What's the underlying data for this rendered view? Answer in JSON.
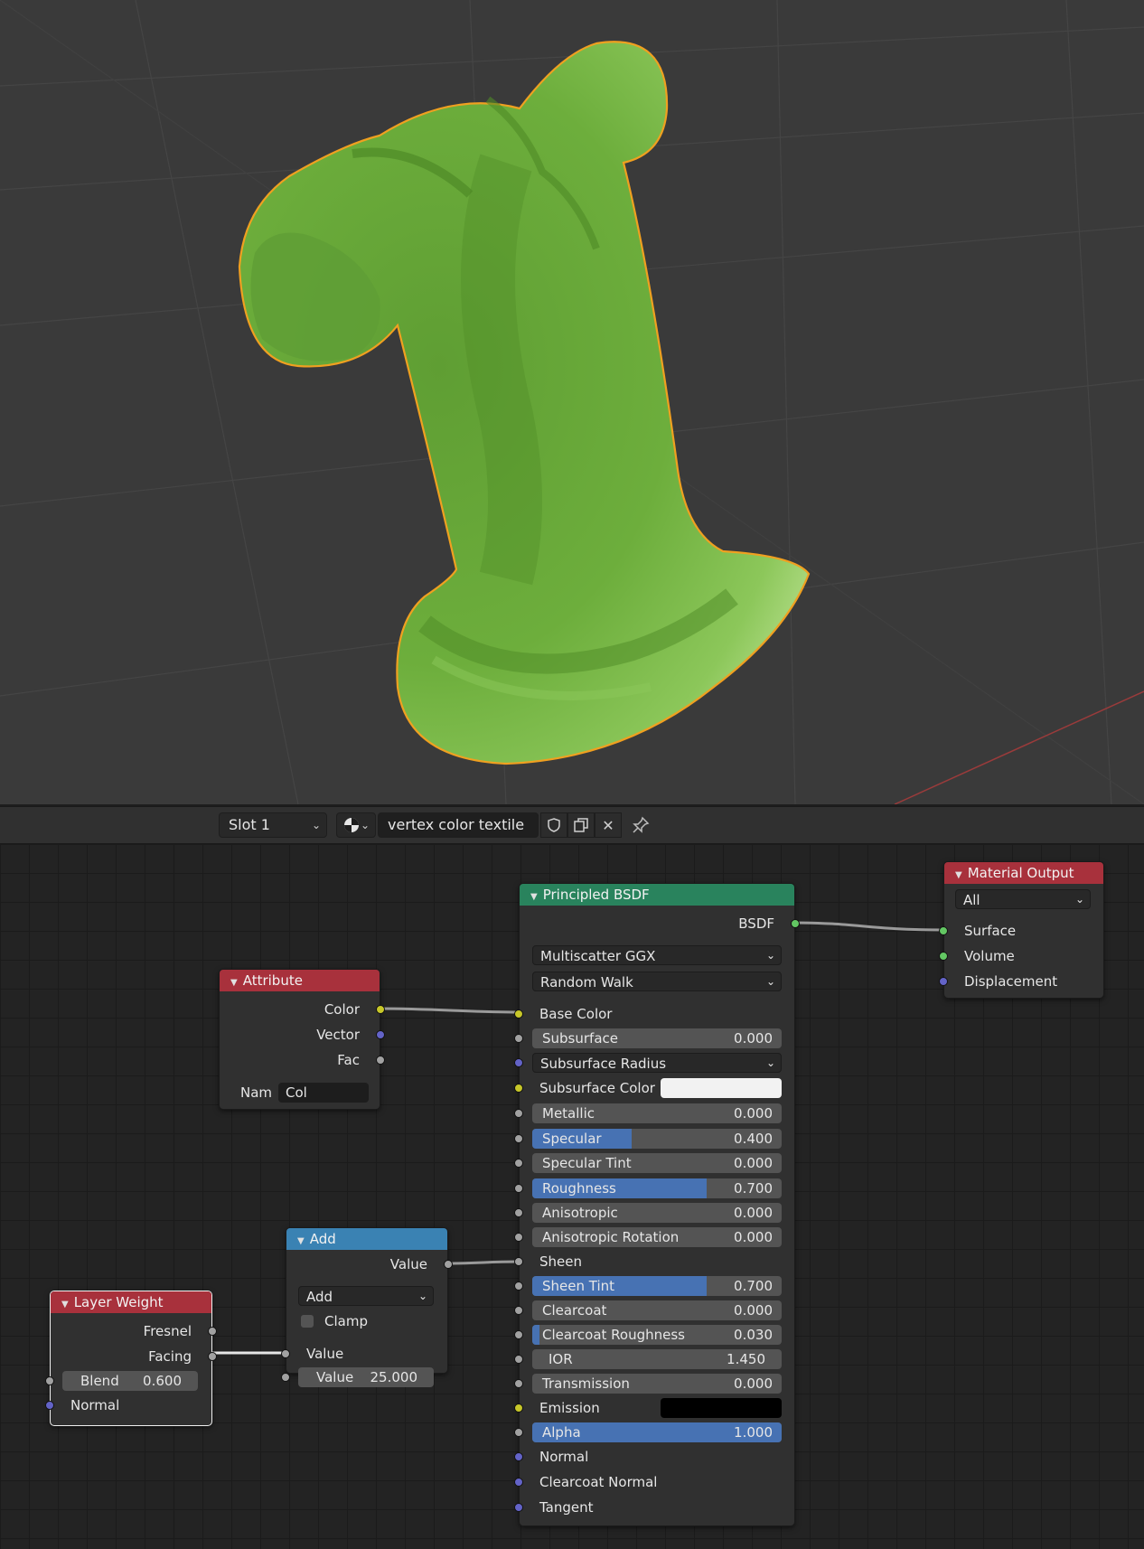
{
  "header": {
    "slot_label": "Slot 1",
    "material_name": "vertex color textile"
  },
  "nodes": {
    "principled": {
      "title": "Principled BSDF",
      "output_label": "BSDF",
      "distribution": "Multiscatter GGX",
      "subsurface_method": "Random Walk",
      "inputs": [
        {
          "label": "Base Color"
        },
        {
          "label": "Subsurface",
          "value": "0.000",
          "fill": 0
        },
        {
          "label": "Subsurface Radius"
        },
        {
          "label": "Subsurface Color",
          "color": "#f2f2f2"
        },
        {
          "label": "Metallic",
          "value": "0.000",
          "fill": 0
        },
        {
          "label": "Specular",
          "value": "0.400",
          "fill": 0.4
        },
        {
          "label": "Specular Tint",
          "value": "0.000",
          "fill": 0
        },
        {
          "label": "Roughness",
          "value": "0.700",
          "fill": 0.7
        },
        {
          "label": "Anisotropic",
          "value": "0.000",
          "fill": 0
        },
        {
          "label": "Anisotropic Rotation",
          "value": "0.000",
          "fill": 0
        },
        {
          "label": "Sheen"
        },
        {
          "label": "Sheen Tint",
          "value": "0.700",
          "fill": 0.7
        },
        {
          "label": "Clearcoat",
          "value": "0.000",
          "fill": 0
        },
        {
          "label": "Clearcoat Roughness",
          "value": "0.030",
          "fill": 0.03
        },
        {
          "label": "IOR",
          "value": "1.450"
        },
        {
          "label": "Transmission",
          "value": "0.000",
          "fill": 0
        },
        {
          "label": "Emission",
          "color": "#000000"
        },
        {
          "label": "Alpha",
          "value": "1.000",
          "fill": 1
        },
        {
          "label": "Normal"
        },
        {
          "label": "Clearcoat Normal"
        },
        {
          "label": "Tangent"
        }
      ]
    },
    "material_output": {
      "title": "Material Output",
      "target": "All",
      "inputs": [
        "Surface",
        "Volume",
        "Displacement"
      ]
    },
    "attribute": {
      "title": "Attribute",
      "outputs": [
        "Color",
        "Vector",
        "Fac"
      ],
      "name_label": "Nam",
      "name_value": "Col"
    },
    "add": {
      "title": "Add",
      "output_label": "Value",
      "operation": "Add",
      "clamp_label": "Clamp",
      "input1_label": "Value",
      "input2_label": "Value",
      "input2_value": "25.000"
    },
    "layer_weight": {
      "title": "Layer Weight",
      "outputs": [
        "Fresnel",
        "Facing"
      ],
      "blend_label": "Blend",
      "blend_value": "0.600",
      "normal_label": "Normal"
    }
  },
  "colors": {
    "shader_header": "#29835d",
    "input_header": "#a8313c",
    "converter_header": "#3a82b3",
    "output_header": "#a8313c",
    "model_green": "#6fb23c",
    "selection_outline": "#f0a020"
  }
}
